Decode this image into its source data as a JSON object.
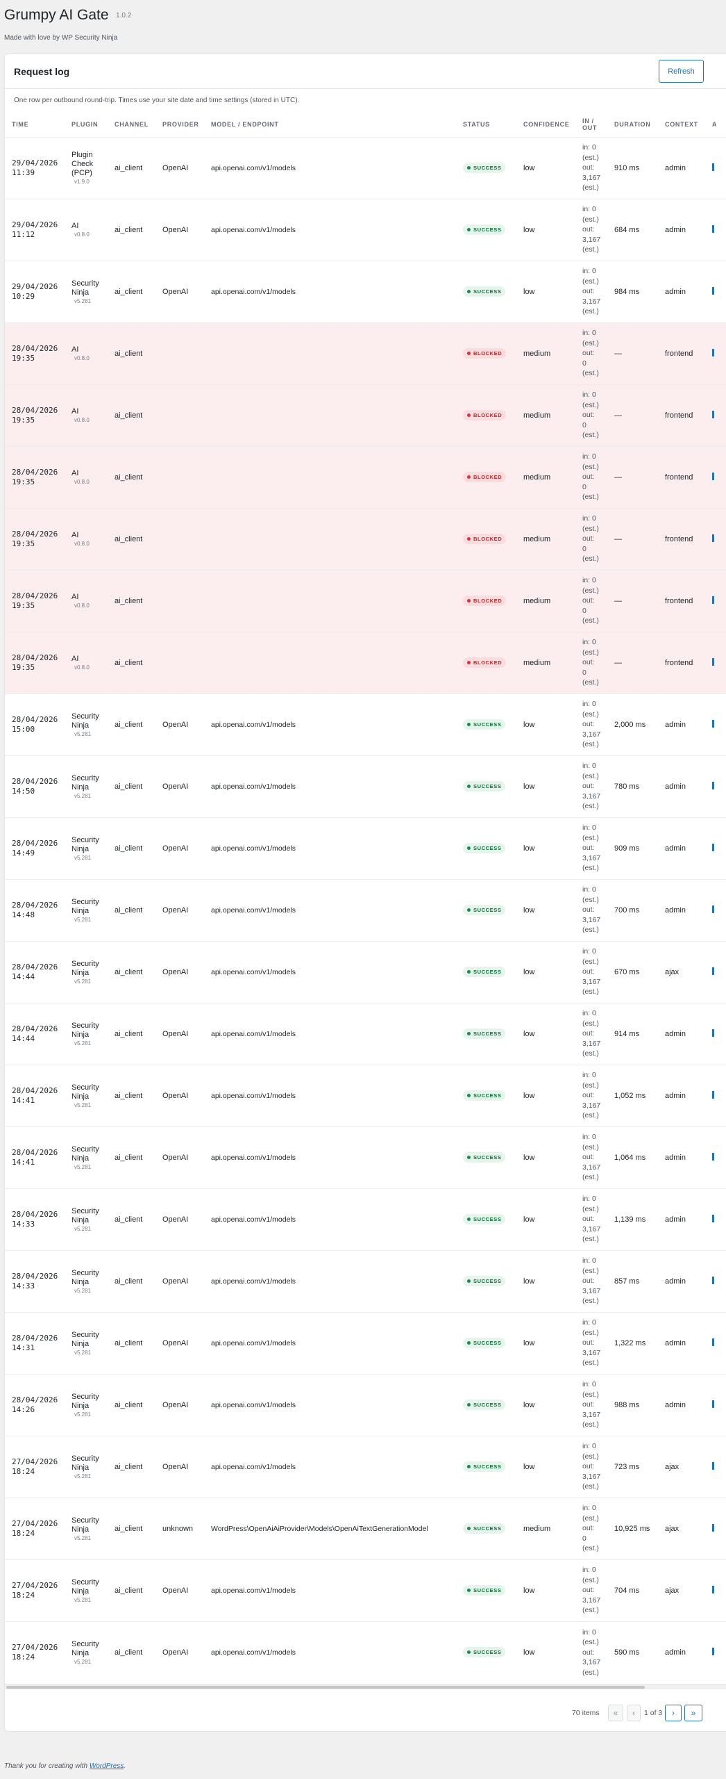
{
  "app": {
    "title": "Grumpy AI Gate",
    "version": "1.0.2",
    "tagline": "Made with love by WP Security Ninja"
  },
  "card": {
    "title": "Request log",
    "refresh_label": "Refresh",
    "description": "One row per outbound round-trip. Times use your site date and time settings (stored in UTC)."
  },
  "columns": {
    "time": "TIME",
    "plugin": "PLUGIN",
    "channel": "CHANNEL",
    "provider": "PROVIDER",
    "model": "MODEL / ENDPOINT",
    "status": "STATUS",
    "confidence": "CONFIDENCE",
    "io_line1": "IN /",
    "io_line2": "OUT",
    "duration": "DURATION",
    "context": "CONTEXT",
    "extra": "A"
  },
  "rows": [
    {
      "date": "29/04/2026",
      "time": "11:39",
      "plugin": "Plugin Check (PCP)",
      "version": "v1.9.0",
      "channel": "ai_client",
      "provider": "OpenAI",
      "model": "api.openai.com/v1/models",
      "status": "SUCCESS",
      "kind": "success",
      "confidence": "low",
      "io": [
        "in: 0",
        "(est.)",
        "out:",
        "3,167",
        "(est.)"
      ],
      "duration": "910 ms",
      "context": "admin"
    },
    {
      "date": "29/04/2026",
      "time": "11:12",
      "plugin": "AI",
      "version": "v0.8.0",
      "channel": "ai_client",
      "provider": "OpenAI",
      "model": "api.openai.com/v1/models",
      "status": "SUCCESS",
      "kind": "success",
      "confidence": "low",
      "io": [
        "in: 0",
        "(est.)",
        "out:",
        "3,167",
        "(est.)"
      ],
      "duration": "684 ms",
      "context": "admin"
    },
    {
      "date": "29/04/2026",
      "time": "10:29",
      "plugin": "Security Ninja",
      "version": "v5.281",
      "channel": "ai_client",
      "provider": "OpenAI",
      "model": "api.openai.com/v1/models",
      "status": "SUCCESS",
      "kind": "success",
      "confidence": "low",
      "io": [
        "in: 0",
        "(est.)",
        "out:",
        "3,167",
        "(est.)"
      ],
      "duration": "984 ms",
      "context": "admin"
    },
    {
      "date": "28/04/2026",
      "time": "19:35",
      "plugin": "AI",
      "version": "v0.8.0",
      "channel": "ai_client",
      "provider": "",
      "model": "",
      "status": "BLOCKED",
      "kind": "blocked",
      "confidence": "medium",
      "io": [
        "in: 0",
        "(est.)",
        "out:",
        "0",
        "(est.)"
      ],
      "duration": "—",
      "context": "frontend"
    },
    {
      "date": "28/04/2026",
      "time": "19:35",
      "plugin": "AI",
      "version": "v0.8.0",
      "channel": "ai_client",
      "provider": "",
      "model": "",
      "status": "BLOCKED",
      "kind": "blocked",
      "confidence": "medium",
      "io": [
        "in: 0",
        "(est.)",
        "out:",
        "0",
        "(est.)"
      ],
      "duration": "—",
      "context": "frontend"
    },
    {
      "date": "28/04/2026",
      "time": "19:35",
      "plugin": "AI",
      "version": "v0.8.0",
      "channel": "ai_client",
      "provider": "",
      "model": "",
      "status": "BLOCKED",
      "kind": "blocked",
      "confidence": "medium",
      "io": [
        "in: 0",
        "(est.)",
        "out:",
        "0",
        "(est.)"
      ],
      "duration": "—",
      "context": "frontend"
    },
    {
      "date": "28/04/2026",
      "time": "19:35",
      "plugin": "AI",
      "version": "v0.8.0",
      "channel": "ai_client",
      "provider": "",
      "model": "",
      "status": "BLOCKED",
      "kind": "blocked",
      "confidence": "medium",
      "io": [
        "in: 0",
        "(est.)",
        "out:",
        "0",
        "(est.)"
      ],
      "duration": "—",
      "context": "frontend"
    },
    {
      "date": "28/04/2026",
      "time": "19:35",
      "plugin": "AI",
      "version": "v0.8.0",
      "channel": "ai_client",
      "provider": "",
      "model": "",
      "status": "BLOCKED",
      "kind": "blocked",
      "confidence": "medium",
      "io": [
        "in: 0",
        "(est.)",
        "out:",
        "0",
        "(est.)"
      ],
      "duration": "—",
      "context": "frontend"
    },
    {
      "date": "28/04/2026",
      "time": "19:35",
      "plugin": "AI",
      "version": "v0.8.0",
      "channel": "ai_client",
      "provider": "",
      "model": "",
      "status": "BLOCKED",
      "kind": "blocked",
      "confidence": "medium",
      "io": [
        "in: 0",
        "(est.)",
        "out:",
        "0",
        "(est.)"
      ],
      "duration": "—",
      "context": "frontend"
    },
    {
      "date": "28/04/2026",
      "time": "15:00",
      "plugin": "Security Ninja",
      "version": "v5.281",
      "channel": "ai_client",
      "provider": "OpenAI",
      "model": "api.openai.com/v1/models",
      "status": "SUCCESS",
      "kind": "success",
      "confidence": "low",
      "io": [
        "in: 0",
        "(est.)",
        "out:",
        "3,167",
        "(est.)"
      ],
      "duration": "2,000 ms",
      "context": "admin"
    },
    {
      "date": "28/04/2026",
      "time": "14:50",
      "plugin": "Security Ninja",
      "version": "v5.281",
      "channel": "ai_client",
      "provider": "OpenAI",
      "model": "api.openai.com/v1/models",
      "status": "SUCCESS",
      "kind": "success",
      "confidence": "low",
      "io": [
        "in: 0",
        "(est.)",
        "out:",
        "3,167",
        "(est.)"
      ],
      "duration": "780 ms",
      "context": "admin"
    },
    {
      "date": "28/04/2026",
      "time": "14:49",
      "plugin": "Security Ninja",
      "version": "v5.281",
      "channel": "ai_client",
      "provider": "OpenAI",
      "model": "api.openai.com/v1/models",
      "status": "SUCCESS",
      "kind": "success",
      "confidence": "low",
      "io": [
        "in: 0",
        "(est.)",
        "out:",
        "3,167",
        "(est.)"
      ],
      "duration": "909 ms",
      "context": "admin"
    },
    {
      "date": "28/04/2026",
      "time": "14:48",
      "plugin": "Security Ninja",
      "version": "v5.281",
      "channel": "ai_client",
      "provider": "OpenAI",
      "model": "api.openai.com/v1/models",
      "status": "SUCCESS",
      "kind": "success",
      "confidence": "low",
      "io": [
        "in: 0",
        "(est.)",
        "out:",
        "3,167",
        "(est.)"
      ],
      "duration": "700 ms",
      "context": "admin"
    },
    {
      "date": "28/04/2026",
      "time": "14:44",
      "plugin": "Security Ninja",
      "version": "v5.281",
      "channel": "ai_client",
      "provider": "OpenAI",
      "model": "api.openai.com/v1/models",
      "status": "SUCCESS",
      "kind": "success",
      "confidence": "low",
      "io": [
        "in: 0",
        "(est.)",
        "out:",
        "3,167",
        "(est.)"
      ],
      "duration": "670 ms",
      "context": "ajax"
    },
    {
      "date": "28/04/2026",
      "time": "14:44",
      "plugin": "Security Ninja",
      "version": "v5.281",
      "channel": "ai_client",
      "provider": "OpenAI",
      "model": "api.openai.com/v1/models",
      "status": "SUCCESS",
      "kind": "success",
      "confidence": "low",
      "io": [
        "in: 0",
        "(est.)",
        "out:",
        "3,167",
        "(est.)"
      ],
      "duration": "914 ms",
      "context": "admin"
    },
    {
      "date": "28/04/2026",
      "time": "14:41",
      "plugin": "Security Ninja",
      "version": "v5.281",
      "channel": "ai_client",
      "provider": "OpenAI",
      "model": "api.openai.com/v1/models",
      "status": "SUCCESS",
      "kind": "success",
      "confidence": "low",
      "io": [
        "in: 0",
        "(est.)",
        "out:",
        "3,167",
        "(est.)"
      ],
      "duration": "1,052 ms",
      "context": "admin"
    },
    {
      "date": "28/04/2026",
      "time": "14:41",
      "plugin": "Security Ninja",
      "version": "v5.281",
      "channel": "ai_client",
      "provider": "OpenAI",
      "model": "api.openai.com/v1/models",
      "status": "SUCCESS",
      "kind": "success",
      "confidence": "low",
      "io": [
        "in: 0",
        "(est.)",
        "out:",
        "3,167",
        "(est.)"
      ],
      "duration": "1,064 ms",
      "context": "admin"
    },
    {
      "date": "28/04/2026",
      "time": "14:33",
      "plugin": "Security Ninja",
      "version": "v5.281",
      "channel": "ai_client",
      "provider": "OpenAI",
      "model": "api.openai.com/v1/models",
      "status": "SUCCESS",
      "kind": "success",
      "confidence": "low",
      "io": [
        "in: 0",
        "(est.)",
        "out:",
        "3,167",
        "(est.)"
      ],
      "duration": "1,139 ms",
      "context": "admin"
    },
    {
      "date": "28/04/2026",
      "time": "14:33",
      "plugin": "Security Ninja",
      "version": "v5.281",
      "channel": "ai_client",
      "provider": "OpenAI",
      "model": "api.openai.com/v1/models",
      "status": "SUCCESS",
      "kind": "success",
      "confidence": "low",
      "io": [
        "in: 0",
        "(est.)",
        "out:",
        "3,167",
        "(est.)"
      ],
      "duration": "857 ms",
      "context": "admin"
    },
    {
      "date": "28/04/2026",
      "time": "14:31",
      "plugin": "Security Ninja",
      "version": "v5.281",
      "channel": "ai_client",
      "provider": "OpenAI",
      "model": "api.openai.com/v1/models",
      "status": "SUCCESS",
      "kind": "success",
      "confidence": "low",
      "io": [
        "in: 0",
        "(est.)",
        "out:",
        "3,167",
        "(est.)"
      ],
      "duration": "1,322 ms",
      "context": "admin"
    },
    {
      "date": "28/04/2026",
      "time": "14:26",
      "plugin": "Security Ninja",
      "version": "v5.281",
      "channel": "ai_client",
      "provider": "OpenAI",
      "model": "api.openai.com/v1/models",
      "status": "SUCCESS",
      "kind": "success",
      "confidence": "low",
      "io": [
        "in: 0",
        "(est.)",
        "out:",
        "3,167",
        "(est.)"
      ],
      "duration": "988 ms",
      "context": "admin"
    },
    {
      "date": "27/04/2026",
      "time": "18:24",
      "plugin": "Security Ninja",
      "version": "v5.281",
      "channel": "ai_client",
      "provider": "OpenAI",
      "model": "api.openai.com/v1/models",
      "status": "SUCCESS",
      "kind": "success",
      "confidence": "low",
      "io": [
        "in: 0",
        "(est.)",
        "out:",
        "3,167",
        "(est.)"
      ],
      "duration": "723 ms",
      "context": "ajax"
    },
    {
      "date": "27/04/2026",
      "time": "18:24",
      "plugin": "Security Ninja",
      "version": "v5.281",
      "channel": "ai_client",
      "provider": "unknown",
      "model": "WordPress\\OpenAiAiProvider\\Models\\OpenAiTextGenerationModel",
      "status": "SUCCESS",
      "kind": "success",
      "confidence": "medium",
      "io": [
        "in: 0",
        "(est.)",
        "out:",
        "0",
        "(est.)"
      ],
      "duration": "10,925 ms",
      "context": "ajax"
    },
    {
      "date": "27/04/2026",
      "time": "18:24",
      "plugin": "Security Ninja",
      "version": "v5.281",
      "channel": "ai_client",
      "provider": "OpenAI",
      "model": "api.openai.com/v1/models",
      "status": "SUCCESS",
      "kind": "success",
      "confidence": "low",
      "io": [
        "in: 0",
        "(est.)",
        "out:",
        "3,167",
        "(est.)"
      ],
      "duration": "704 ms",
      "context": "ajax"
    },
    {
      "date": "27/04/2026",
      "time": "18:24",
      "plugin": "Security Ninja",
      "version": "v5.281",
      "channel": "ai_client",
      "provider": "OpenAI",
      "model": "api.openai.com/v1/models",
      "status": "SUCCESS",
      "kind": "success",
      "confidence": "low",
      "io": [
        "in: 0",
        "(est.)",
        "out:",
        "3,167",
        "(est.)"
      ],
      "duration": "590 ms",
      "context": "admin"
    }
  ],
  "pagination": {
    "count": "70 items",
    "first": "«",
    "prev": "‹",
    "page": "1 of 3",
    "next": "›",
    "last": "»"
  },
  "footer": {
    "prefix": "Thank you for creating with ",
    "link": "WordPress",
    "suffix": "."
  },
  "colors": {
    "accent": "#2271b1",
    "success_bg": "#e5f5ec",
    "blocked_row_bg": "#fceeef",
    "blocked_text": "#b32d2e"
  }
}
